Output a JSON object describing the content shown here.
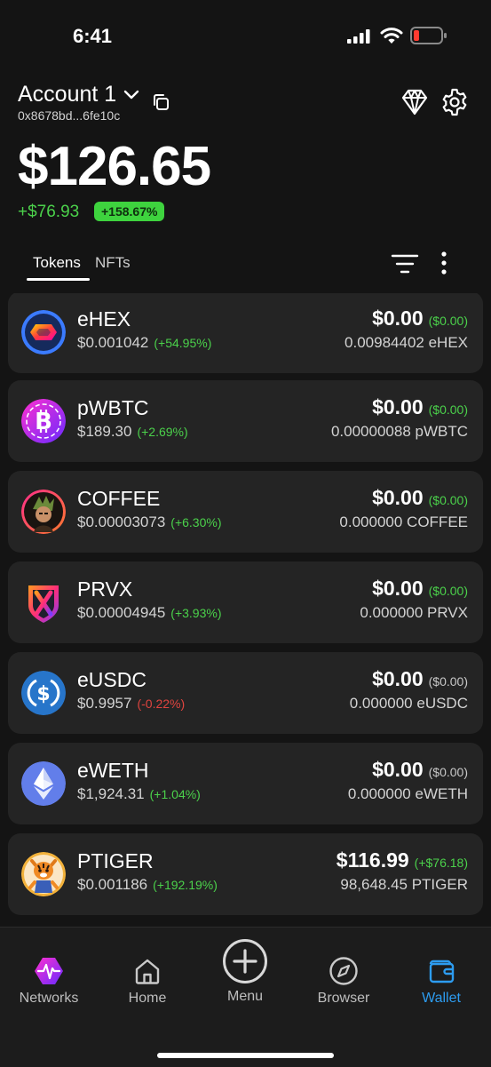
{
  "status_bar": {
    "time": "6:41"
  },
  "account": {
    "name": "Account 1",
    "address": "0x8678bd...6fe10c",
    "balance": "$126.65",
    "change": "+$76.93",
    "change_pct": "+158.67%"
  },
  "tabs": {
    "tokens": "Tokens",
    "nfts": "NFTs"
  },
  "colors": {
    "accent": "#2d9cf0",
    "positive": "#4bd14b",
    "negative": "#e0443f",
    "card": "#242424"
  },
  "tokens": [
    {
      "symbol": "eHEX",
      "price": "$0.001042",
      "pct": "(+54.95%)",
      "value": "$0.00",
      "value_change": "($0.00)",
      "amount": "0.00984402 eHEX",
      "icon": "hex-icon"
    },
    {
      "symbol": "pWBTC",
      "price": "$189.30",
      "pct": "(+2.69%)",
      "value": "$0.00",
      "value_change": "($0.00)",
      "amount": "0.00000088 pWBTC",
      "icon": "bitcoin-icon"
    },
    {
      "symbol": "COFFEE",
      "price": "$0.00003073",
      "pct": "(+6.30%)",
      "value": "$0.00",
      "value_change": "($0.00)",
      "amount": "0.000000 COFFEE",
      "icon": "coffee-token-icon"
    },
    {
      "symbol": "PRVX",
      "price": "$0.00004945",
      "pct": "(+3.93%)",
      "value": "$0.00",
      "value_change": "($0.00)",
      "amount": "0.000000 PRVX",
      "icon": "prvx-shield-icon"
    },
    {
      "symbol": "eUSDC",
      "price": "$0.9957",
      "pct": "(-0.22%)",
      "value": "$0.00",
      "value_change": "($0.00)",
      "amount": "0.000000 eUSDC",
      "icon": "usdc-icon"
    },
    {
      "symbol": "eWETH",
      "price": "$1,924.31",
      "pct": "(+1.04%)",
      "value": "$0.00",
      "value_change": "($0.00)",
      "amount": "0.000000 eWETH",
      "icon": "ethereum-icon"
    },
    {
      "symbol": "PTIGER",
      "price": "$0.001186",
      "pct": "(+192.19%)",
      "value": "$116.99",
      "value_change": "(+$76.18)",
      "amount": "98,648.45 PTIGER",
      "icon": "tiger-icon"
    }
  ],
  "nav": {
    "networks": "Networks",
    "home": "Home",
    "menu": "Menu",
    "browser": "Browser",
    "wallet": "Wallet"
  }
}
